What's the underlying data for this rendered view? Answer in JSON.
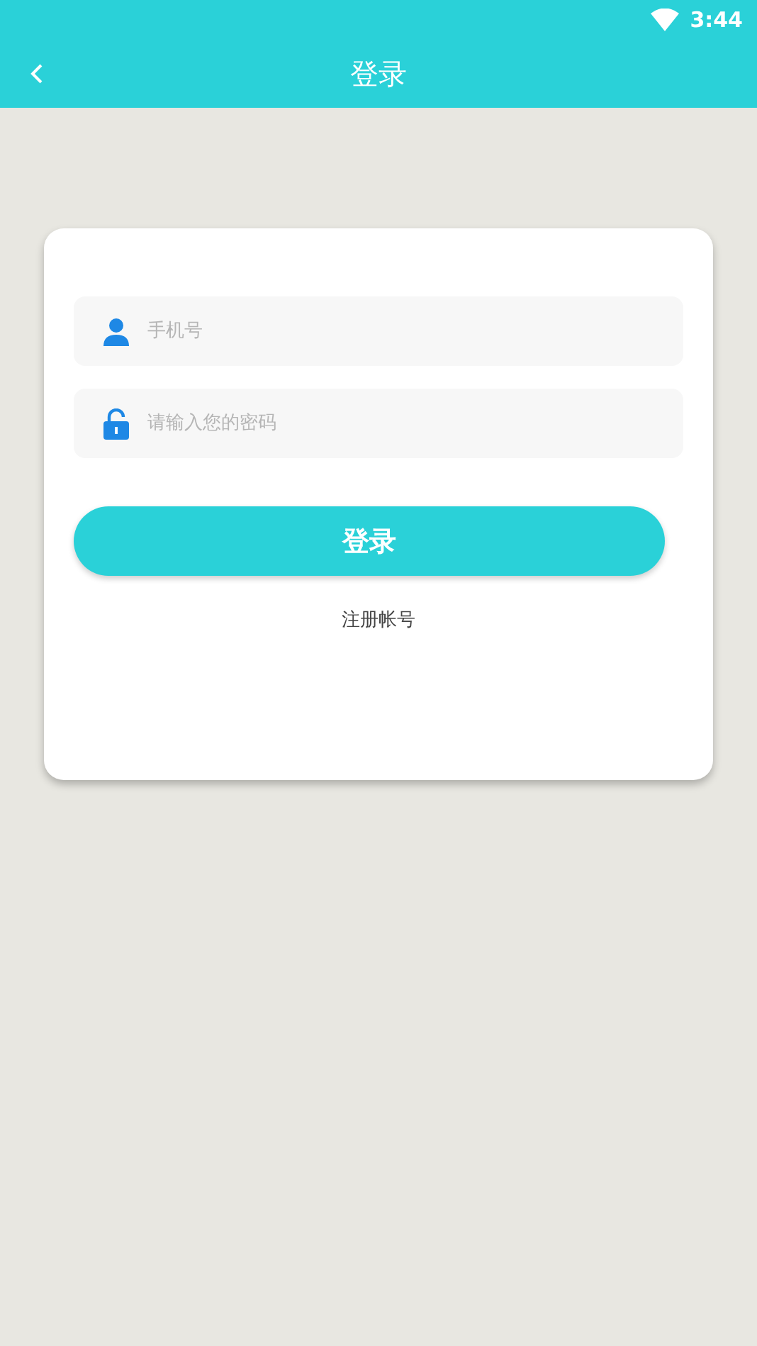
{
  "status_bar": {
    "time": "3:44"
  },
  "header": {
    "title": "登录"
  },
  "form": {
    "phone": {
      "placeholder": "手机号"
    },
    "password": {
      "placeholder": "请输入您的密码"
    },
    "submit": "登录",
    "register_link": "注册帐号"
  }
}
